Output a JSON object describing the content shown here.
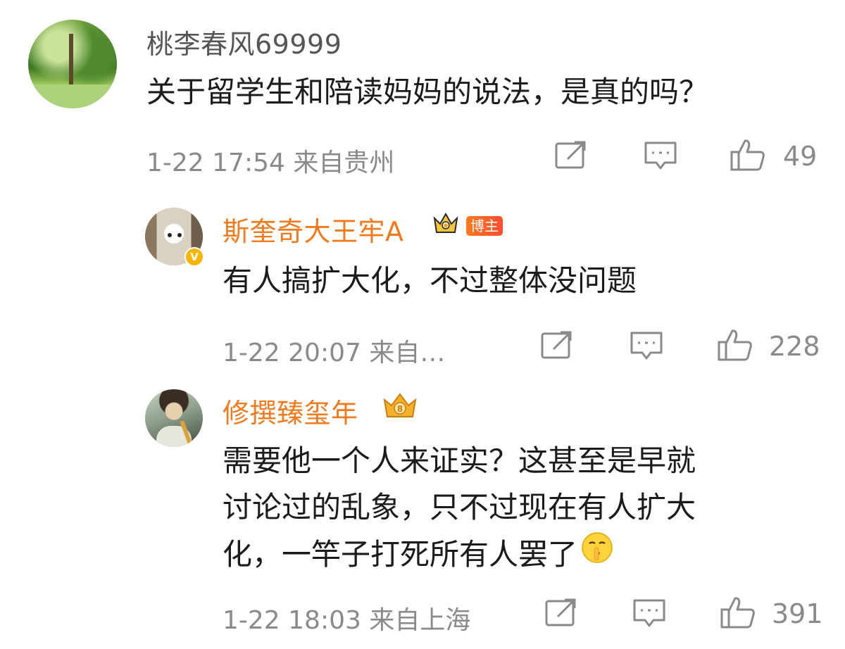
{
  "comment": {
    "username": "桃李春风69999",
    "text": "关于留学生和陪读妈妈的说法，是真的吗？",
    "meta": "1-22 17:54  来自贵州",
    "likes": "49"
  },
  "replies": [
    {
      "username": "斯奎奇大王牢A",
      "badge": "博主",
      "verified": "V",
      "text": "有人搞扩大化，不过整体没问题",
      "meta": "1-22 20:07  来自…",
      "likes": "228"
    },
    {
      "username": "修撰臻玺年",
      "text_lines": [
        "需要他一个人来证实？这甚至是早就",
        "讨论过的乱象，只不过现在有人扩大",
        "化，一竿子打死所有人罢了"
      ],
      "meta": "1-22 18:03  来自上海",
      "likes": "391"
    }
  ],
  "colors": {
    "username_highlight": "#f07a1c",
    "meta_gray": "#8a8a8a",
    "icon_gray": "#8a8a8a",
    "host_badge": "#ff5a28",
    "verified_badge": "#f7b500"
  },
  "icons": {
    "repost": "share-edit-icon",
    "comment": "comment-icon",
    "like": "thumbs-up-icon"
  }
}
